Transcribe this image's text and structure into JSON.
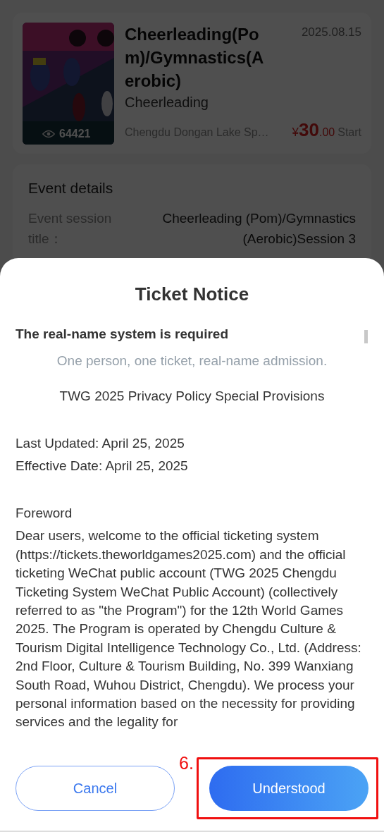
{
  "event_card": {
    "views": "64421",
    "title": "Cheerleading(Pom)/Gymnastics(Aerobic)",
    "date": "2025.08.15",
    "category": "Cheerleading",
    "venue": "Chengdu Dongan Lake Sp…",
    "price": {
      "currency": "¥",
      "integer": "30",
      "decimal": ".00",
      "suffix": "Start"
    }
  },
  "event_details": {
    "heading": "Event details",
    "rows": [
      {
        "label": "Event session title：",
        "value": "Cheerleading (Pom)/Gymnastics (Aerobic)Session 3"
      }
    ]
  },
  "dialog": {
    "title": "Ticket Notice",
    "blocks": [
      {
        "kind": "heading",
        "lines": [
          "The real-name system is required"
        ]
      },
      {
        "kind": "note",
        "lines": [
          "One person, one ticket, real-name admission."
        ]
      },
      {
        "kind": "center",
        "lines": [
          "TWG 2025 Privacy Policy Special Provisions"
        ]
      },
      {
        "kind": "plain",
        "lines": [
          "Last Updated: April 25, 2025",
          "Effective Date: April 25, 2025"
        ]
      },
      {
        "kind": "plain",
        "lines": [
          "Foreword",
          "Dear users, welcome to the official ticketing system (https://tickets.theworldgames2025.com) and the official ticketing WeChat public account (TWG 2025 Chengdu Ticketing System WeChat Public Account) (collectively referred to as \"the Program\") for the 12th World Games 2025. The Program is operated by Chengdu Culture & Tourism Digital Intelligence Technology Co., Ltd. (Address: 2nd Floor, Culture & Tourism Building, No. 399 Wanxiang South Road, Wuhou District, Chengdu). We process your personal information based on the necessity for providing services and the legality for"
        ]
      }
    ],
    "buttons": [
      {
        "label": "Cancel",
        "kind": "secondary"
      },
      {
        "label": "Understood",
        "kind": "primary"
      }
    ]
  },
  "annotation": {
    "label": "6."
  }
}
